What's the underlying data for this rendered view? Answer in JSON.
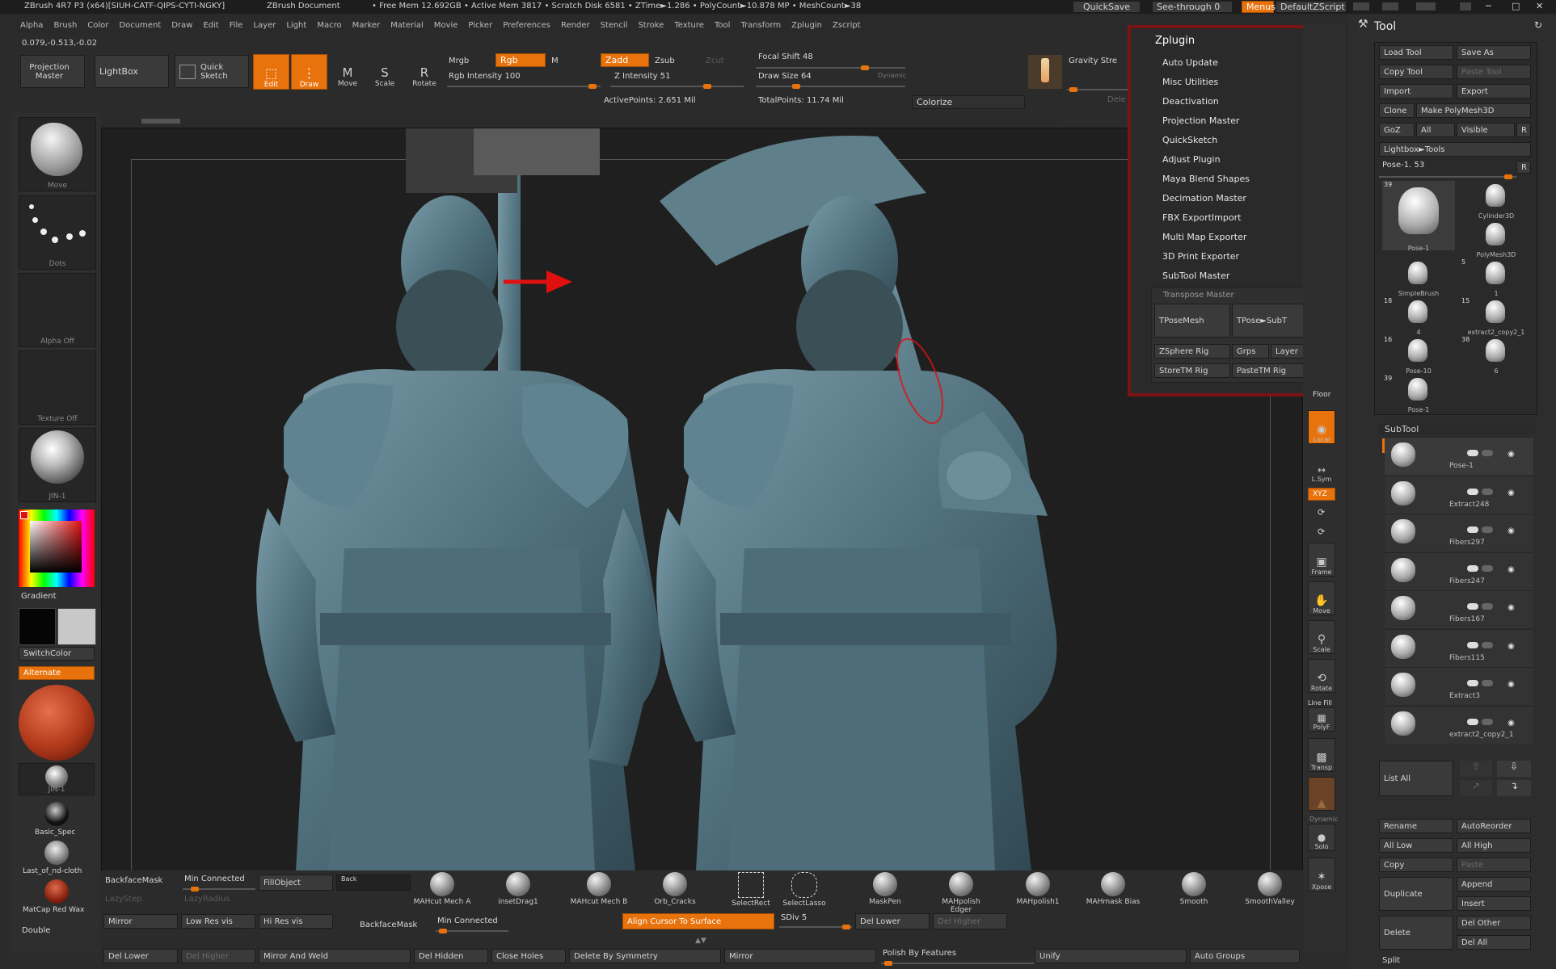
{
  "titlebar": {
    "app_title": "ZBrush 4R7 P3 (x64)[SIUH-CATF-QIPS-CYTI-NGKY]",
    "doc_title": "ZBrush Document",
    "stats": "• Free Mem 12.692GB • Active Mem 3817 • Scratch Disk 6581 • ZTime►1.286 • PolyCount►10.878 MP • MeshCount►38",
    "quicksave": "QuickSave",
    "seethrough": "See-through  0",
    "menus": "Menus",
    "defaultzscript": "DefaultZScript"
  },
  "menubar": [
    "Alpha",
    "Brush",
    "Color",
    "Document",
    "Draw",
    "Edit",
    "File",
    "Layer",
    "Light",
    "Macro",
    "Marker",
    "Material",
    "Movie",
    "Picker",
    "Preferences",
    "Render",
    "Stencil",
    "Stroke",
    "Texture",
    "Tool",
    "Transform",
    "Zplugin",
    "Zscript"
  ],
  "coords": "0.079,-0.513,-0.02",
  "toolbar": {
    "projection_master": "Projection Master",
    "lightbox": "LightBox",
    "quick_sketch": "Quick Sketch",
    "edit": "Edit",
    "draw": "Draw",
    "move": "Move",
    "scale": "Scale",
    "rotate": "Rotate",
    "mrgb": "Mrgb",
    "rgb": "Rgb",
    "m": "M",
    "zadd": "Zadd",
    "zsub": "Zsub",
    "zcut": "Zcut",
    "rgb_intensity": "Rgb Intensity 100",
    "z_intensity": "Z Intensity 51",
    "focal_shift": "Focal Shift 48",
    "draw_size": "Draw Size 64",
    "dynamic": "Dynamic",
    "active_points": "ActivePoints: 2.651 Mil",
    "total_points": "TotalPoints: 11.74 Mil",
    "colorize": "Colorize",
    "gravity": "Gravity Stre",
    "dele": "Dele"
  },
  "left_shelf": {
    "move": "Move",
    "dots": "Dots",
    "alpha_off": "Alpha  Off",
    "texture_off": "Texture  Off",
    "jin1_top": "JIN-1",
    "gradient": "Gradient",
    "switchcolor": "SwitchColor",
    "alternate": "Alternate",
    "jin1_bottom": "JIN-1",
    "basic_spec": "Basic_Spec",
    "last_cloth": "Last_of_nd-cloth",
    "matcap_red": "MatCap  Red  Wax",
    "double": "Double"
  },
  "zplugin": {
    "title": "Zplugin",
    "items": [
      "Auto Update",
      "Misc Utilities",
      "Deactivation",
      "Projection Master",
      "QuickSketch",
      "Adjust Plugin",
      "Maya Blend Shapes",
      "Decimation Master",
      "FBX ExportImport",
      "Multi Map Exporter",
      "3D Print Exporter",
      "SubTool Master"
    ],
    "transpose_master": "Transpose Master",
    "tposemesh": "TPoseMesh",
    "tpose_subt": "TPose►SubT",
    "zsphere_rig": "ZSphere Rig",
    "grps": "Grps",
    "layer": "Layer",
    "storetm_rig": "StoreTM Rig",
    "pastetm_rig": "PasteTM Rig"
  },
  "right_shelf": {
    "floor": "Floor",
    "local": "Local",
    "lsym": "L.Sym",
    "xyz": "XYZ",
    "frame": "Frame",
    "move": "Move",
    "scale": "Scale",
    "rotate": "Rotate",
    "linefill": "Line Fill",
    "polyf": "PolyF",
    "transp": "Transp",
    "dynamic": "Dynamic",
    "solo": "Solo",
    "xpose": "Xpose"
  },
  "tool_panel": {
    "title": "Tool",
    "load_tool": "Load Tool",
    "save_as": "Save As",
    "copy_tool": "Copy Tool",
    "paste_tool": "Paste Tool",
    "import": "Import",
    "export": "Export",
    "clone": "Clone",
    "make_polymesh": "Make PolyMesh3D",
    "goz": "GoZ",
    "all": "All",
    "visible": "Visible",
    "r": "R",
    "lightbox_tools": "Lightbox►Tools",
    "pose_slider": "Pose-1. 53",
    "thumbs": [
      {
        "count": "39",
        "name": "Pose-1"
      },
      {
        "count": "",
        "name": "Cylinder3D"
      },
      {
        "count": "",
        "name": "PolyMesh3D"
      },
      {
        "count": "",
        "name": "SimpleBrush"
      },
      {
        "count": "5",
        "name": "1"
      },
      {
        "count": "18",
        "name": "4"
      },
      {
        "count": "15",
        "name": "extract2_copy2_1"
      },
      {
        "count": "16",
        "name": "Pose-10"
      },
      {
        "count": "38",
        "name": "6"
      },
      {
        "count": "39",
        "name": "Pose-1"
      }
    ],
    "subtool_title": "SubTool",
    "subtools": [
      "Pose-1",
      "Extract248",
      "Fibers297",
      "Fibers247",
      "Fibers167",
      "Fibers115",
      "Extract3",
      "extract2_copy2_1"
    ],
    "list_all": "List  All",
    "rename": "Rename",
    "autoreorder": "AutoReorder",
    "all_low": "All  Low",
    "all_high": "All  High",
    "copy": "Copy",
    "paste": "Paste",
    "append": "Append",
    "duplicate": "Duplicate",
    "insert": "Insert",
    "delete": "Delete",
    "del_other": "Del  Other",
    "del_all": "Del  All",
    "split": "Split"
  },
  "bottom": {
    "backfacemask": "BackfaceMask",
    "min_connected": "Min Connected",
    "fillobject": "FillObject",
    "back": "Back",
    "lazystep": "LazyStep",
    "lazyradius": "LazyRadius",
    "mirror": "Mirror",
    "low_res_vis": "Low Res vis",
    "hi_res_vis": "Hi Res vis",
    "backfacemask2": "BackfaceMask",
    "min_connected2": "Min Connected",
    "align_cursor": "Align Cursor To Surface",
    "sdiv": "SDiv 5",
    "del_lower": "Del Lower",
    "del_higher": "Del Higher",
    "del_lower2": "Del Lower",
    "del_higher2": "Del Higher",
    "mirror_weld": "Mirror And Weld",
    "del_hidden": "Del Hidden",
    "close_holes": "Close Holes",
    "delete_sym": "Delete By Symmetry",
    "mirror2": "Mirror",
    "polish_features": "Polish By Features",
    "unify": "Unify",
    "auto_groups": "Auto Groups",
    "brushes": [
      "MAHcut  Mech  A",
      "insetDrag1",
      "MAHcut  Mech  B",
      "Orb_Cracks",
      "SelectRect",
      "SelectLasso",
      "MaskPen",
      "MAHpolish  Edger",
      "MAHpolish1",
      "MAHmask  Bias",
      "Smooth",
      "SmoothValley"
    ]
  },
  "colors": {
    "accent": "#e8720c",
    "panel": "#2e2e2e",
    "canvas": "#1f1f1f",
    "model": "#5b7d89",
    "annotation": "#e01010"
  }
}
